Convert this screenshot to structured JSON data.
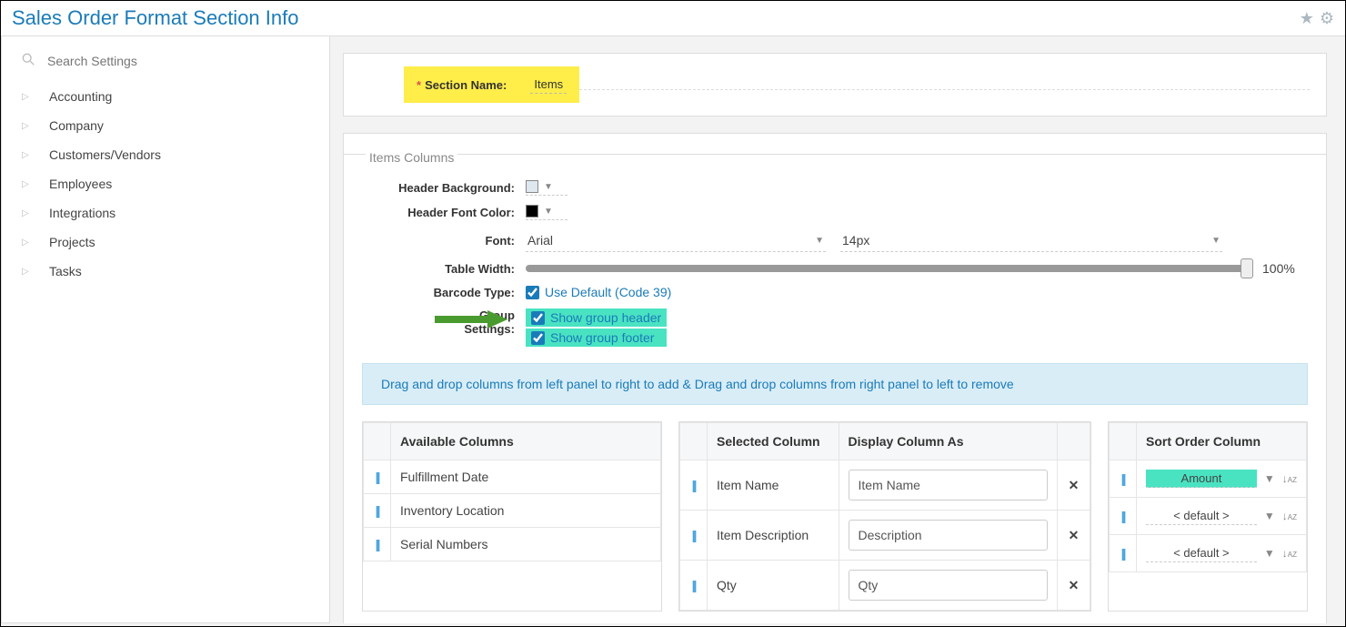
{
  "page_title": "Sales Order Format Section Info",
  "search_placeholder": "Search Settings",
  "sidebar": {
    "items": [
      {
        "label": "Accounting"
      },
      {
        "label": "Company"
      },
      {
        "label": "Customers/Vendors"
      },
      {
        "label": "Employees"
      },
      {
        "label": "Integrations"
      },
      {
        "label": "Projects"
      },
      {
        "label": "Tasks"
      }
    ]
  },
  "section_name": {
    "label": "Section Name:",
    "value": "Items"
  },
  "fieldset_legend": "Items Columns",
  "form": {
    "header_bg_label": "Header Background:",
    "header_bg_color": "#dfe7ef",
    "header_font_color_label": "Header Font Color:",
    "header_font_color": "#000000",
    "font_label": "Font:",
    "font_family": "Arial",
    "font_size": "14px",
    "table_width_label": "Table Width:",
    "table_width_pct": "100%",
    "barcode_label": "Barcode Type:",
    "barcode_checkbox_label": "Use Default (Code 39)",
    "group_label": "Group Settings:",
    "group_header_label": "Show group header",
    "group_footer_label": "Show group footer"
  },
  "info_banner": "Drag and drop columns from left panel to right to add & Drag and drop columns from right panel to left to remove",
  "available": {
    "header": "Available Columns",
    "rows": [
      "Fulfillment Date",
      "Inventory Location",
      "Serial Numbers"
    ]
  },
  "selected": {
    "header_col": "Selected Column",
    "header_disp": "Display Column As",
    "rows": [
      {
        "col": "Item Name",
        "disp": "Item Name"
      },
      {
        "col": "Item Description",
        "disp": "Description"
      },
      {
        "col": "Qty",
        "disp": "Qty"
      }
    ]
  },
  "sort": {
    "header": "Sort Order Column",
    "rows": [
      {
        "val": "Amount",
        "highlight": true
      },
      {
        "val": "< default >",
        "highlight": false
      },
      {
        "val": "< default >",
        "highlight": false
      }
    ]
  }
}
